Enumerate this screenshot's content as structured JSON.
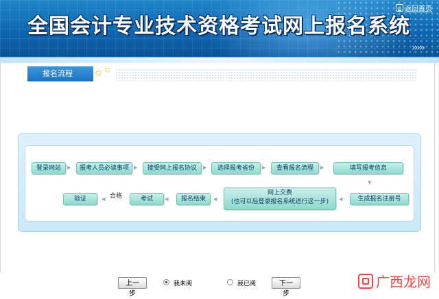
{
  "header": {
    "title": "全国会计专业技术资格考试网上报名系统",
    "home_link": "返回首页"
  },
  "section": {
    "tab_label": "报名流程"
  },
  "flow": {
    "steps": [
      "登录网站",
      "报考人员必读事项",
      "接受网上报名协议",
      "选择报考省份",
      "查看报名流程",
      "填写报考信息",
      "生成报名注册号",
      "网上交费",
      "(也可以后登录报名系统进行这一步)",
      "报名结束",
      "考试",
      "验证"
    ],
    "pass_label": "合格"
  },
  "controls": {
    "prev_label": "上一步",
    "next_label": "下一步",
    "radio_unread": "我未阅",
    "radio_read": "我已阅",
    "selected": "我未阅"
  },
  "watermark": {
    "text": "广西龙网"
  },
  "colors": {
    "header_blue": "#0d64ad",
    "step_fill": "#8fd9cd",
    "tab_blue": "#1f72bf",
    "watermark_red": "#e83a3a"
  }
}
